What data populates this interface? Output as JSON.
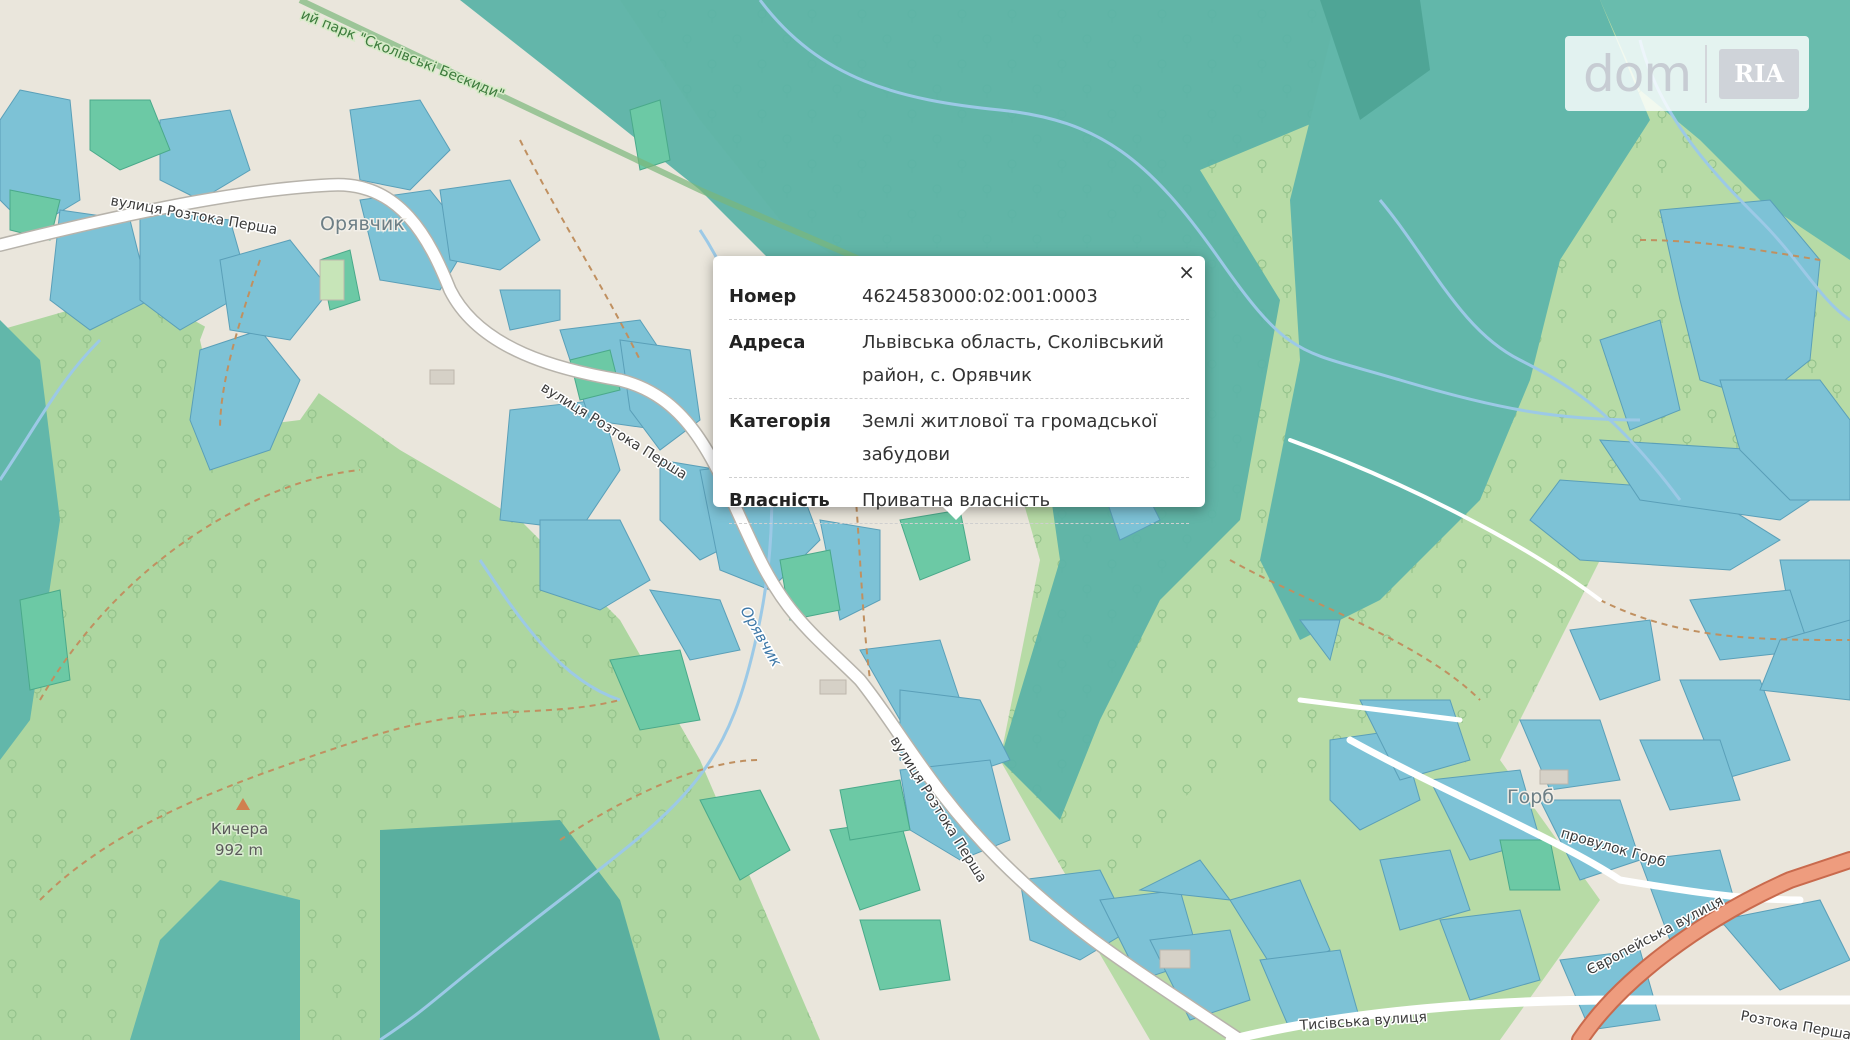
{
  "map": {
    "labels": {
      "street_1": "вулиця Розтока Перша",
      "street_2": "вулиця Розтока Перша",
      "street_3": "вулиця Розтока Перша",
      "village": "Орявчик",
      "river": "Орявчик",
      "park": "ий парк \"Сколівські Бескиди\"",
      "peak_name": "Кичера",
      "peak_elevation": "992 m",
      "hamlet": "Горб",
      "lane": "провулок Горб",
      "avenue": "Європейська вулиця",
      "tysivska": "Тисівська вулиця",
      "rozhmuchka": "Розтока Перша"
    },
    "colors": {
      "background": "#eae6dc",
      "forest": "#a9d49b",
      "deep_forest": "#5fb4a4",
      "parcel_residential": "#7fc3d6",
      "parcel_agri": "#67c9a9",
      "road": "#ffffff",
      "main_road": "#e99a7c"
    }
  },
  "logo": {
    "text": "dom",
    "sub": "RIA"
  },
  "popup": {
    "close_label": "×",
    "rows": [
      {
        "key": "Номер",
        "value": "4624583000:02:001:0003"
      },
      {
        "key": "Адреса",
        "value": "Львівська область, Сколівський район, с. Орявчик"
      },
      {
        "key": "Категорія",
        "value": "Землі житлової та громадської забудови"
      },
      {
        "key": "Власність",
        "value": "Приватна власність"
      }
    ]
  }
}
